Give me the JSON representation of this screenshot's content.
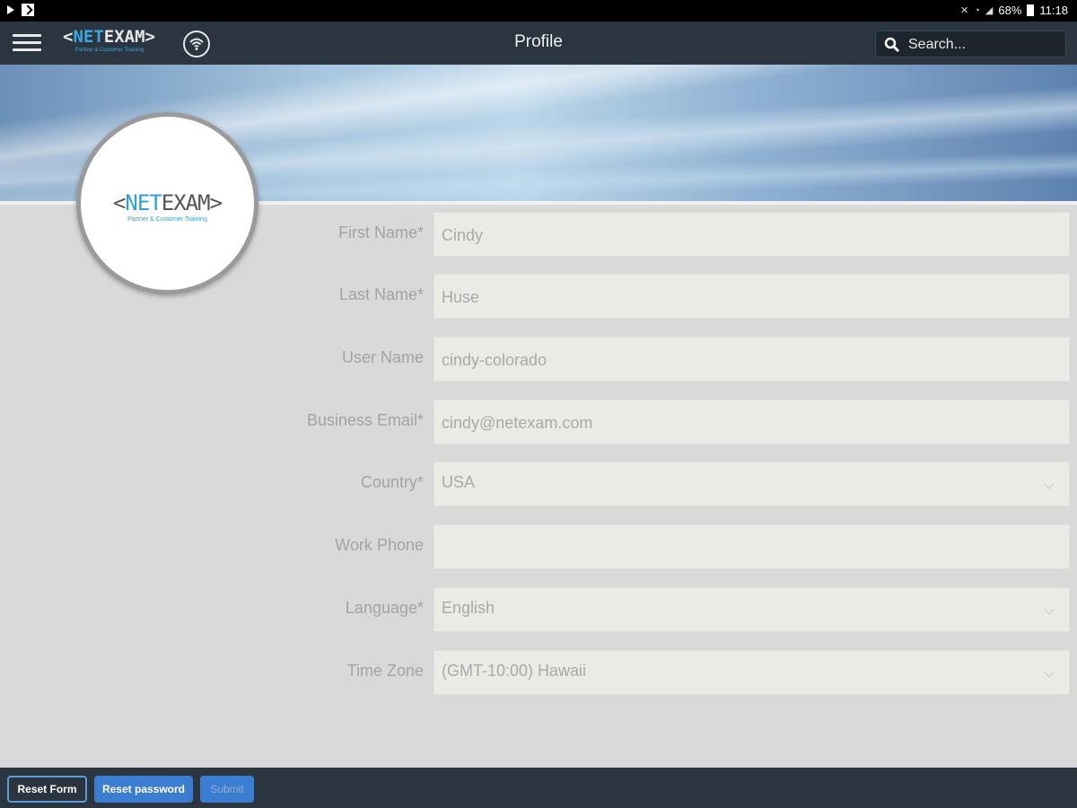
{
  "status_bar": {
    "battery": "68%",
    "time": "11:18"
  },
  "header": {
    "brand_prefix": "<",
    "brand_net": "NET",
    "brand_exam": "EXAM",
    "brand_suffix": ">",
    "brand_tagline": "Partner & Customer Training",
    "title": "Profile",
    "search_placeholder": "Search..."
  },
  "avatar": {
    "brand_prefix": "<",
    "brand_net": "NET",
    "brand_exam": "EXAM",
    "brand_suffix": ">",
    "tagline": "Partner & Customer Training"
  },
  "form": {
    "fields": [
      {
        "label": "First Name*",
        "value": "Cindy",
        "type": "text"
      },
      {
        "label": "Last Name*",
        "value": "Huse",
        "type": "text"
      },
      {
        "label": "User Name",
        "value": "cindy-colorado",
        "type": "text"
      },
      {
        "label": "Business Email*",
        "value": "cindy@netexam.com",
        "type": "text"
      },
      {
        "label": "Country*",
        "value": "USA",
        "type": "select"
      },
      {
        "label": "Work Phone",
        "value": "",
        "type": "text"
      },
      {
        "label": "Language*",
        "value": "English",
        "type": "select"
      },
      {
        "label": "Time Zone",
        "value": "(GMT-10:00) Hawaii",
        "type": "select"
      }
    ]
  },
  "footer": {
    "reset_form": "Reset Form",
    "reset_password": "Reset password",
    "submit": "Submit"
  },
  "colors": {
    "header_bg": "#2b3540",
    "accent_blue": "#3b7dd0",
    "brand_blue": "#3aa8e0",
    "page_bg": "#d9d9d9"
  }
}
